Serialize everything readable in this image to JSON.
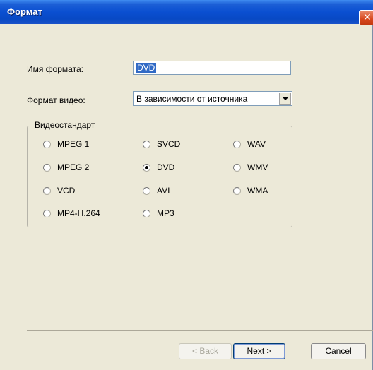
{
  "window": {
    "title": "Формат",
    "close_glyph": "✕"
  },
  "form": {
    "name_label": "Имя формата:",
    "name_value": "DVD",
    "video_format_label": "Формат видео:",
    "video_format_value": "В зависимости от источника"
  },
  "group": {
    "legend": "Видеостандарт",
    "options": [
      {
        "label": "MPEG 1",
        "checked": false
      },
      {
        "label": "MPEG 2",
        "checked": false
      },
      {
        "label": "VCD",
        "checked": false
      },
      {
        "label": "MP4-H.264",
        "checked": false
      },
      {
        "label": "SVCD",
        "checked": false
      },
      {
        "label": "DVD",
        "checked": true
      },
      {
        "label": "AVI",
        "checked": false
      },
      {
        "label": "MP3",
        "checked": false
      },
      {
        "label": "WAV",
        "checked": false
      },
      {
        "label": "WMV",
        "checked": false
      },
      {
        "label": "WMA",
        "checked": false
      }
    ]
  },
  "buttons": {
    "back_label": "< Back",
    "next_label": "Next >",
    "cancel_label": "Cancel"
  }
}
